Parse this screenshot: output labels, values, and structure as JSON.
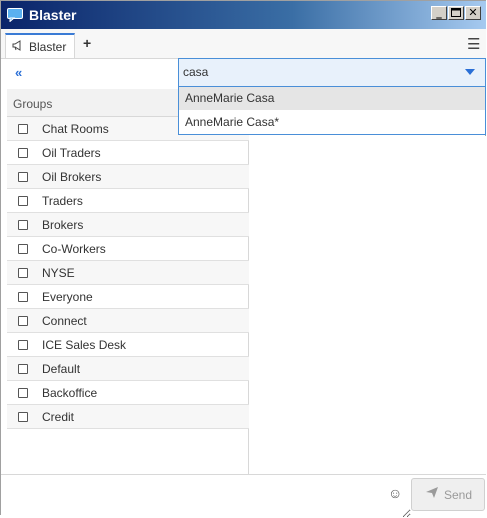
{
  "window": {
    "title": "Blaster"
  },
  "tabs": [
    {
      "label": "Blaster"
    }
  ],
  "search": {
    "value": "casa"
  },
  "dropdown": {
    "items": [
      "AnneMarie Casa",
      "AnneMarie Casa*"
    ]
  },
  "groups": {
    "header": "Groups",
    "items": [
      "Chat Rooms",
      "Oil Traders",
      "Oil Brokers",
      "Traders",
      "Brokers",
      "Co-Workers",
      "NYSE",
      "Everyone",
      "Connect",
      "ICE Sales Desk",
      "Default",
      "Backoffice",
      "Credit"
    ]
  },
  "compose": {
    "send_label": "Send"
  },
  "icons": {
    "app": "chat-bubble-icon",
    "tab": "megaphone-icon",
    "add": "plus-icon",
    "menu": "hamburger-menu-icon",
    "collapse": "double-chevron-left-icon",
    "dropdown": "caret-down-icon",
    "emoji": "smiley-icon",
    "send": "paper-plane-icon"
  },
  "colors": {
    "accent": "#2a6fd6",
    "titlebar_start": "#0a246a",
    "titlebar_end": "#a6caf0"
  }
}
